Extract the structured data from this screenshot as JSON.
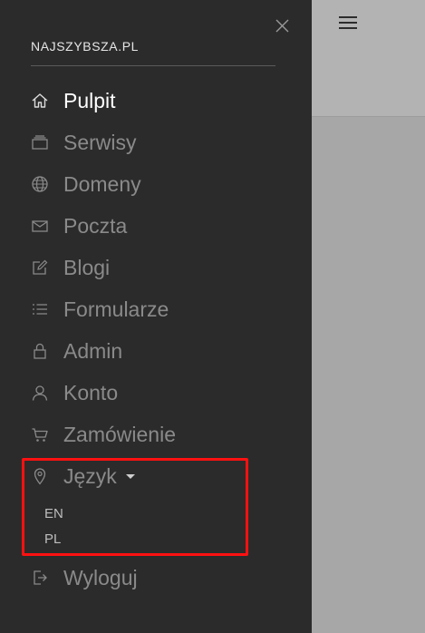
{
  "brand": {
    "title": "NAJSZYBSZA.PL"
  },
  "menu": {
    "items": [
      {
        "label": "Pulpit",
        "icon": "home-icon"
      },
      {
        "label": "Serwisy",
        "icon": "stack-icon"
      },
      {
        "label": "Domeny",
        "icon": "globe-icon"
      },
      {
        "label": "Poczta",
        "icon": "envelope-icon"
      },
      {
        "label": "Blogi",
        "icon": "edit-icon"
      },
      {
        "label": "Formularze",
        "icon": "list-icon"
      },
      {
        "label": "Admin",
        "icon": "lock-icon"
      },
      {
        "label": "Konto",
        "icon": "user-icon"
      },
      {
        "label": "Zamówienie",
        "icon": "cart-icon"
      },
      {
        "label": "Język",
        "icon": "location-pin-icon"
      },
      {
        "label": "Wyloguj",
        "icon": "logout-icon"
      }
    ],
    "language_options": [
      "EN",
      "PL"
    ]
  },
  "colors": {
    "drawer_bg": "#2b2b2b",
    "active_text": "#ffffff",
    "inactive_text": "#8a8a8a",
    "highlight": "#ff1111"
  }
}
